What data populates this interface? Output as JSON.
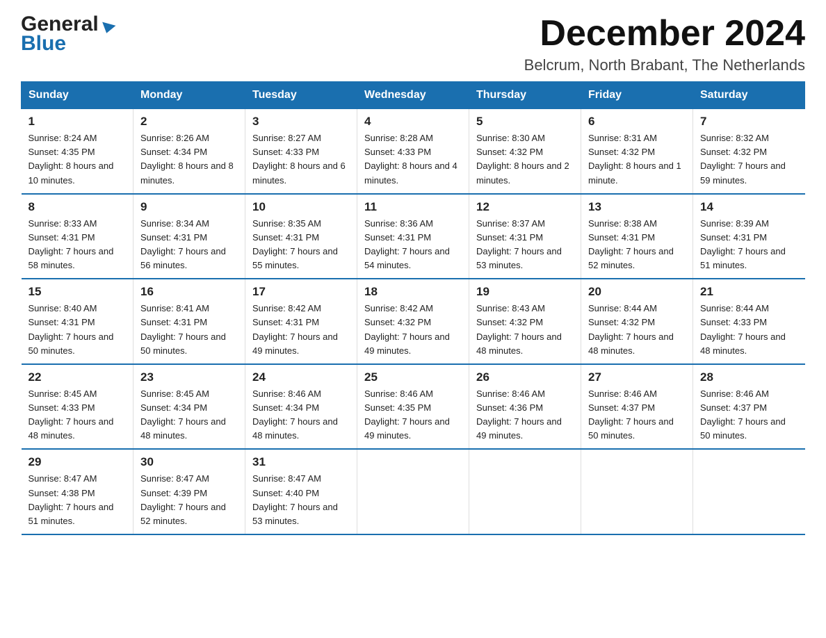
{
  "logo": {
    "general": "General",
    "blue": "Blue"
  },
  "header": {
    "month": "December 2024",
    "location": "Belcrum, North Brabant, The Netherlands"
  },
  "days_of_week": [
    "Sunday",
    "Monday",
    "Tuesday",
    "Wednesday",
    "Thursday",
    "Friday",
    "Saturday"
  ],
  "weeks": [
    [
      {
        "day": "1",
        "sunrise": "8:24 AM",
        "sunset": "4:35 PM",
        "daylight": "8 hours and 10 minutes."
      },
      {
        "day": "2",
        "sunrise": "8:26 AM",
        "sunset": "4:34 PM",
        "daylight": "8 hours and 8 minutes."
      },
      {
        "day": "3",
        "sunrise": "8:27 AM",
        "sunset": "4:33 PM",
        "daylight": "8 hours and 6 minutes."
      },
      {
        "day": "4",
        "sunrise": "8:28 AM",
        "sunset": "4:33 PM",
        "daylight": "8 hours and 4 minutes."
      },
      {
        "day": "5",
        "sunrise": "8:30 AM",
        "sunset": "4:32 PM",
        "daylight": "8 hours and 2 minutes."
      },
      {
        "day": "6",
        "sunrise": "8:31 AM",
        "sunset": "4:32 PM",
        "daylight": "8 hours and 1 minute."
      },
      {
        "day": "7",
        "sunrise": "8:32 AM",
        "sunset": "4:32 PM",
        "daylight": "7 hours and 59 minutes."
      }
    ],
    [
      {
        "day": "8",
        "sunrise": "8:33 AM",
        "sunset": "4:31 PM",
        "daylight": "7 hours and 58 minutes."
      },
      {
        "day": "9",
        "sunrise": "8:34 AM",
        "sunset": "4:31 PM",
        "daylight": "7 hours and 56 minutes."
      },
      {
        "day": "10",
        "sunrise": "8:35 AM",
        "sunset": "4:31 PM",
        "daylight": "7 hours and 55 minutes."
      },
      {
        "day": "11",
        "sunrise": "8:36 AM",
        "sunset": "4:31 PM",
        "daylight": "7 hours and 54 minutes."
      },
      {
        "day": "12",
        "sunrise": "8:37 AM",
        "sunset": "4:31 PM",
        "daylight": "7 hours and 53 minutes."
      },
      {
        "day": "13",
        "sunrise": "8:38 AM",
        "sunset": "4:31 PM",
        "daylight": "7 hours and 52 minutes."
      },
      {
        "day": "14",
        "sunrise": "8:39 AM",
        "sunset": "4:31 PM",
        "daylight": "7 hours and 51 minutes."
      }
    ],
    [
      {
        "day": "15",
        "sunrise": "8:40 AM",
        "sunset": "4:31 PM",
        "daylight": "7 hours and 50 minutes."
      },
      {
        "day": "16",
        "sunrise": "8:41 AM",
        "sunset": "4:31 PM",
        "daylight": "7 hours and 50 minutes."
      },
      {
        "day": "17",
        "sunrise": "8:42 AM",
        "sunset": "4:31 PM",
        "daylight": "7 hours and 49 minutes."
      },
      {
        "day": "18",
        "sunrise": "8:42 AM",
        "sunset": "4:32 PM",
        "daylight": "7 hours and 49 minutes."
      },
      {
        "day": "19",
        "sunrise": "8:43 AM",
        "sunset": "4:32 PM",
        "daylight": "7 hours and 48 minutes."
      },
      {
        "day": "20",
        "sunrise": "8:44 AM",
        "sunset": "4:32 PM",
        "daylight": "7 hours and 48 minutes."
      },
      {
        "day": "21",
        "sunrise": "8:44 AM",
        "sunset": "4:33 PM",
        "daylight": "7 hours and 48 minutes."
      }
    ],
    [
      {
        "day": "22",
        "sunrise": "8:45 AM",
        "sunset": "4:33 PM",
        "daylight": "7 hours and 48 minutes."
      },
      {
        "day": "23",
        "sunrise": "8:45 AM",
        "sunset": "4:34 PM",
        "daylight": "7 hours and 48 minutes."
      },
      {
        "day": "24",
        "sunrise": "8:46 AM",
        "sunset": "4:34 PM",
        "daylight": "7 hours and 48 minutes."
      },
      {
        "day": "25",
        "sunrise": "8:46 AM",
        "sunset": "4:35 PM",
        "daylight": "7 hours and 49 minutes."
      },
      {
        "day": "26",
        "sunrise": "8:46 AM",
        "sunset": "4:36 PM",
        "daylight": "7 hours and 49 minutes."
      },
      {
        "day": "27",
        "sunrise": "8:46 AM",
        "sunset": "4:37 PM",
        "daylight": "7 hours and 50 minutes."
      },
      {
        "day": "28",
        "sunrise": "8:46 AM",
        "sunset": "4:37 PM",
        "daylight": "7 hours and 50 minutes."
      }
    ],
    [
      {
        "day": "29",
        "sunrise": "8:47 AM",
        "sunset": "4:38 PM",
        "daylight": "7 hours and 51 minutes."
      },
      {
        "day": "30",
        "sunrise": "8:47 AM",
        "sunset": "4:39 PM",
        "daylight": "7 hours and 52 minutes."
      },
      {
        "day": "31",
        "sunrise": "8:47 AM",
        "sunset": "4:40 PM",
        "daylight": "7 hours and 53 minutes."
      },
      null,
      null,
      null,
      null
    ]
  ],
  "labels": {
    "sunrise": "Sunrise: ",
    "sunset": "Sunset: ",
    "daylight": "Daylight: "
  }
}
